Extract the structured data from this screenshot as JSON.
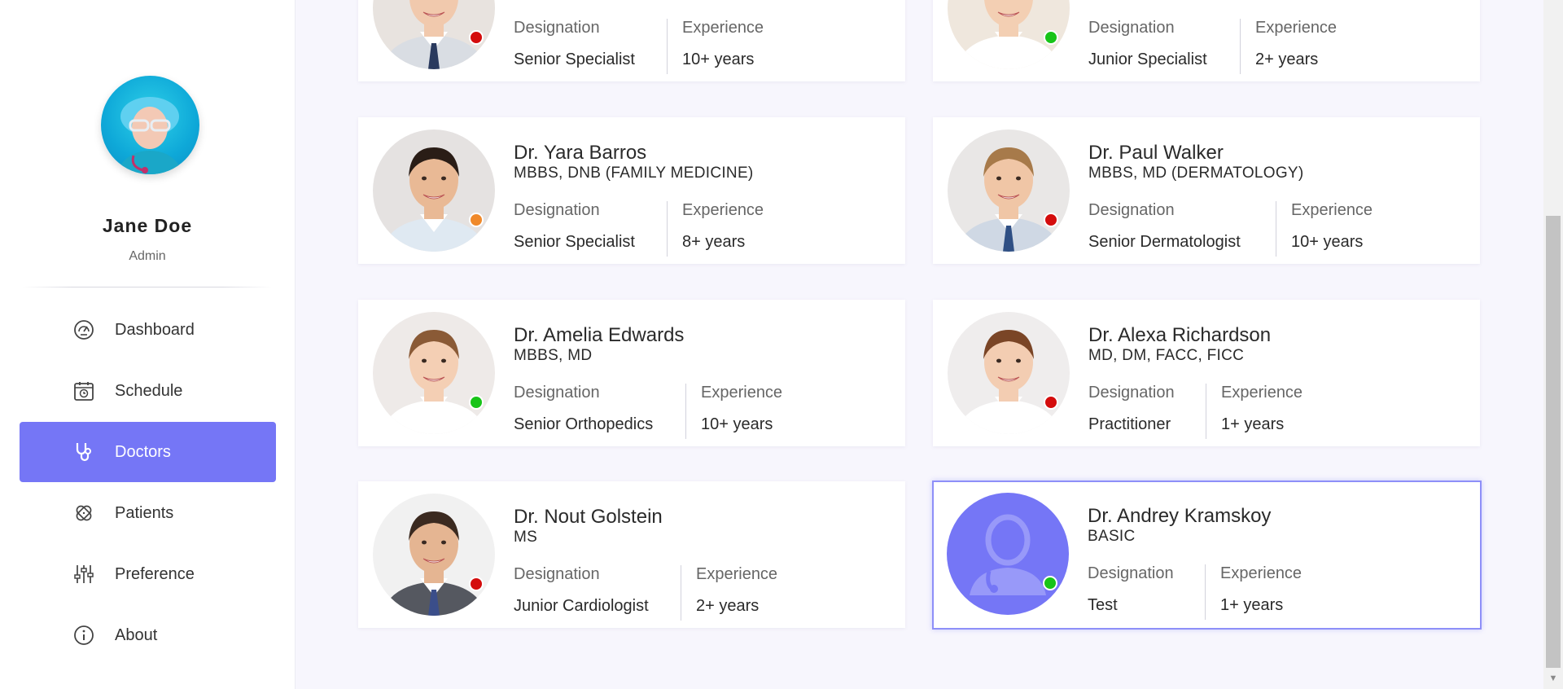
{
  "sidebar": {
    "user": {
      "name": "Jane Doe",
      "role": "Admin"
    },
    "items": [
      {
        "label": "Dashboard",
        "icon": "gauge-icon",
        "active": false
      },
      {
        "label": "Schedule",
        "icon": "calendar-clock-icon",
        "active": false
      },
      {
        "label": "Doctors",
        "icon": "stethoscope-icon",
        "active": true
      },
      {
        "label": "Patients",
        "icon": "bandage-icon",
        "active": false
      },
      {
        "label": "Preference",
        "icon": "sliders-icon",
        "active": false
      },
      {
        "label": "About",
        "icon": "info-icon",
        "active": false
      }
    ]
  },
  "labels": {
    "designation": "Designation",
    "experience": "Experience"
  },
  "doctors": [
    {
      "name": "",
      "qualification": "",
      "designation": "Senior Specialist",
      "experience": "10+ years",
      "status": "busy"
    },
    {
      "name": "",
      "qualification": "",
      "designation": "Junior Specialist",
      "experience": "2+ years",
      "status": "online"
    },
    {
      "name": "Dr. Yara Barros",
      "qualification": "MBBS, DNB (FAMILY MEDICINE)",
      "designation": "Senior Specialist",
      "experience": "8+ years",
      "status": "away"
    },
    {
      "name": "Dr. Paul Walker",
      "qualification": "MBBS, MD (DERMATOLOGY)",
      "designation": "Senior Dermatologist",
      "experience": "10+ years",
      "status": "busy"
    },
    {
      "name": "Dr. Amelia Edwards",
      "qualification": "MBBS, MD",
      "designation": "Senior Orthopedics",
      "experience": "10+ years",
      "status": "online"
    },
    {
      "name": "Dr. Alexa Richardson",
      "qualification": "MD, DM, FACC, FICC",
      "designation": "Practitioner",
      "experience": "1+ years",
      "status": "busy"
    },
    {
      "name": "Dr. Nout Golstein",
      "qualification": "MS",
      "designation": "Junior Cardiologist",
      "experience": "2+ years",
      "status": "busy"
    },
    {
      "name": "Dr. Andrey Kramskoy",
      "qualification": "BASIC",
      "designation": "Test",
      "experience": "1+ years",
      "status": "online",
      "placeholder_avatar": true,
      "selected": true
    }
  ],
  "colors": {
    "accent": "#7576f6",
    "status_online": "#18c418",
    "status_busy": "#d40c0c",
    "status_away": "#f0892a"
  }
}
